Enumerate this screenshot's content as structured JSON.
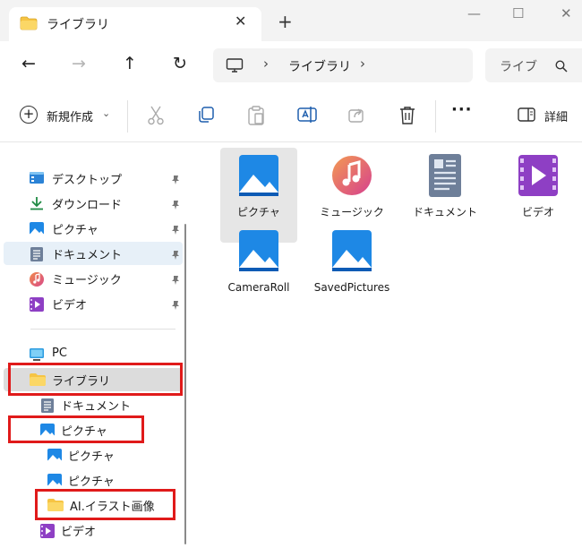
{
  "window": {
    "tab_label": "ライブラリ",
    "tab_close": "✕",
    "new_tab": "+",
    "minimize": "—",
    "maximize": "☐",
    "close": "✕"
  },
  "address": {
    "back": "←",
    "forward": "→",
    "up": "↑",
    "refresh": "↻",
    "separator": "›",
    "crumb": "ライブラリ",
    "search_placeholder": "ライブ"
  },
  "commands": {
    "new_label": "新規作成",
    "new_chevron": "⌄",
    "more": "···",
    "details_label": "詳細"
  },
  "nav": {
    "quick_access": [
      {
        "label": "デスクトップ",
        "icon": "desktop-icon"
      },
      {
        "label": "ダウンロード",
        "icon": "download-icon"
      },
      {
        "label": "ピクチャ",
        "icon": "pictures-icon"
      },
      {
        "label": "ドキュメント",
        "icon": "documents-icon"
      },
      {
        "label": "ミュージック",
        "icon": "music-icon"
      },
      {
        "label": "ビデオ",
        "icon": "videos-icon"
      }
    ],
    "tree": [
      {
        "label": "PC",
        "icon": "pc-icon"
      },
      {
        "label": "ライブラリ",
        "icon": "folder-icon"
      },
      {
        "label": "ドキュメント",
        "icon": "documents-icon"
      },
      {
        "label": "ピクチャ",
        "icon": "pictures-icon"
      },
      {
        "label": "ピクチャ",
        "icon": "pictures-icon"
      },
      {
        "label": "ピクチャ",
        "icon": "pictures-icon"
      },
      {
        "label": "AI.イラスト画像",
        "icon": "folder-icon"
      },
      {
        "label": "ビデオ",
        "icon": "videos-icon"
      }
    ]
  },
  "content": {
    "items": [
      {
        "label": "ピクチャ",
        "icon": "pictures-icon"
      },
      {
        "label": "ミュージック",
        "icon": "music-icon"
      },
      {
        "label": "ドキュメント",
        "icon": "documents-icon"
      },
      {
        "label": "ビデオ",
        "icon": "videos-icon"
      },
      {
        "label": "CameraRoll",
        "icon": "pictures-icon"
      },
      {
        "label": "SavedPictures",
        "icon": "pictures-icon"
      }
    ]
  },
  "colors": {
    "highlight_box": "#e01a1a",
    "nav_selected": "#e7f0f8",
    "tile_selected": "#e6e6e6",
    "folder": "#f6c443"
  }
}
